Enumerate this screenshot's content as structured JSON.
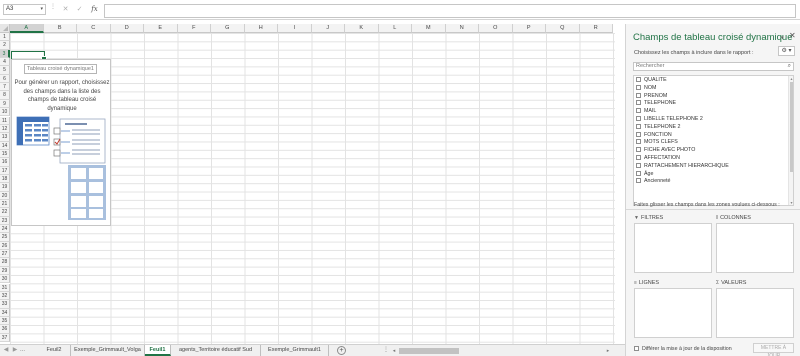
{
  "formula_bar": {
    "name_box": "A3",
    "cancel_glyph": "✕",
    "enter_glyph": "✓",
    "function_glyph": "fx",
    "formula_value": ""
  },
  "grid": {
    "columns": [
      "A",
      "B",
      "C",
      "D",
      "E",
      "F",
      "G",
      "H",
      "I",
      "J",
      "K",
      "L",
      "M",
      "N",
      "O",
      "P",
      "Q",
      "R"
    ],
    "rows": [
      "1",
      "2",
      "3",
      "4",
      "5",
      "6",
      "7",
      "8",
      "9",
      "10",
      "11",
      "12",
      "13",
      "14",
      "15",
      "16",
      "17",
      "18",
      "19",
      "20",
      "21",
      "22",
      "23",
      "24",
      "25",
      "26",
      "27",
      "28",
      "29",
      "30",
      "31",
      "32",
      "33",
      "34",
      "35",
      "36",
      "37"
    ],
    "selected_column": "A",
    "selected_row": "3"
  },
  "pivot_placeholder": {
    "tag": "Tableau croisé dynamique1",
    "message": "Pour générer un rapport, choisissez des champs dans la liste des champs de tableau croisé dynamique"
  },
  "sheet_tabs": {
    "ellipsis": "...",
    "tabs": [
      "Feuil2",
      "Exemple_Grimmault_Volga",
      "Feuil1",
      "agents_Territoire éducatif Sud",
      "Exemple_Grimmault1"
    ],
    "active": "Feuil1",
    "add_glyph": "+",
    "separator_glyph": "⋮"
  },
  "pane": {
    "title": "Champs de tableau croisé dynamique",
    "close_glyph": "✕",
    "dropdown_glyph": "▾",
    "subtitle": "Choisissez les champs à inclure dans le rapport :",
    "gear_glyph": "⚙ ▾",
    "search_placeholder": "Rechercher",
    "search_glyph": "⌕",
    "fields": [
      "QUALITE",
      "NOM",
      "PRENOM",
      "TELEPHONE",
      "MAIL",
      "LIBELLE TELEPHONE 2",
      "TELEPHONE 2",
      "FONCTION",
      "MOTS CLEFS",
      "FICHE AVEC PHOTO",
      "AFFECTATION",
      "RATTACHEMENT HIERARCHIQUE",
      "Âge",
      "Ancienneté"
    ],
    "drag_hint": "Faites glisser les champs dans les zones voulues ci-dessous :",
    "zones": {
      "filters": "FILTRES",
      "columns": "COLONNES",
      "rows": "LIGNES",
      "values": "VALEURS"
    },
    "defer_label": "Différer la mise à jour de la disposition",
    "update_button": "METTRE À JOUR"
  },
  "colors": {
    "accent": "#217346",
    "pane_background": "#f5f5f5",
    "illustration_blue": "#5b87c5"
  },
  "icons": {
    "filters_icon": "▼",
    "columns_icon": "‖",
    "rows_icon": "≡",
    "values_icon": "Σ"
  }
}
